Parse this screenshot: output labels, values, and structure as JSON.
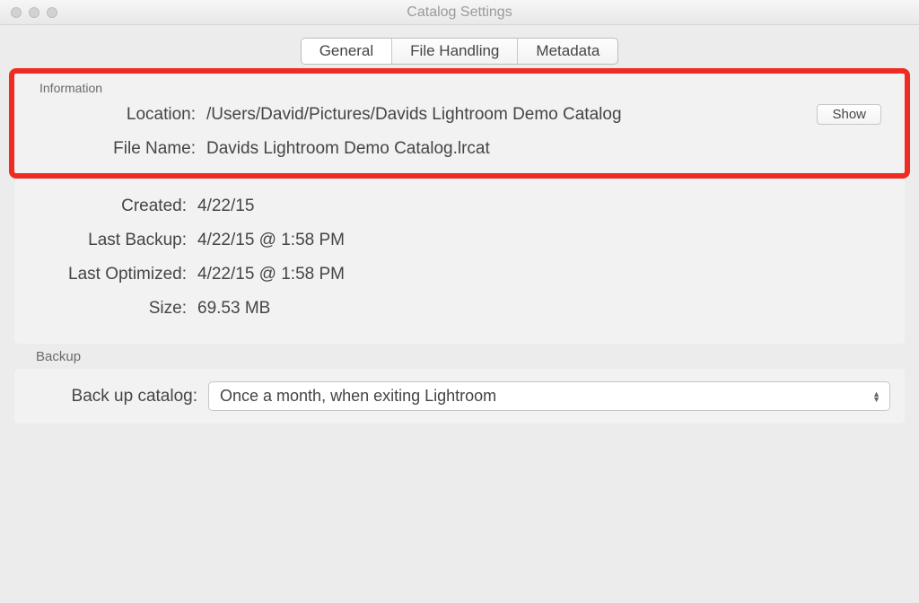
{
  "window": {
    "title": "Catalog Settings"
  },
  "tabs": {
    "general": "General",
    "file_handling": "File Handling",
    "metadata": "Metadata",
    "active": "general"
  },
  "information": {
    "legend": "Information",
    "location_label": "Location:",
    "location_value": "/Users/David/Pictures/Davids Lightroom Demo Catalog",
    "show_button": "Show",
    "filename_label": "File Name:",
    "filename_value": "Davids Lightroom Demo Catalog.lrcat",
    "created_label": "Created:",
    "created_value": "4/22/15",
    "last_backup_label": "Last Backup:",
    "last_backup_value": "4/22/15 @ 1:58 PM",
    "last_optimized_label": "Last Optimized:",
    "last_optimized_value": "4/22/15 @ 1:58 PM",
    "size_label": "Size:",
    "size_value": "69.53 MB"
  },
  "backup": {
    "legend": "Backup",
    "label": "Back up catalog:",
    "selected": "Once a month, when exiting Lightroom"
  }
}
